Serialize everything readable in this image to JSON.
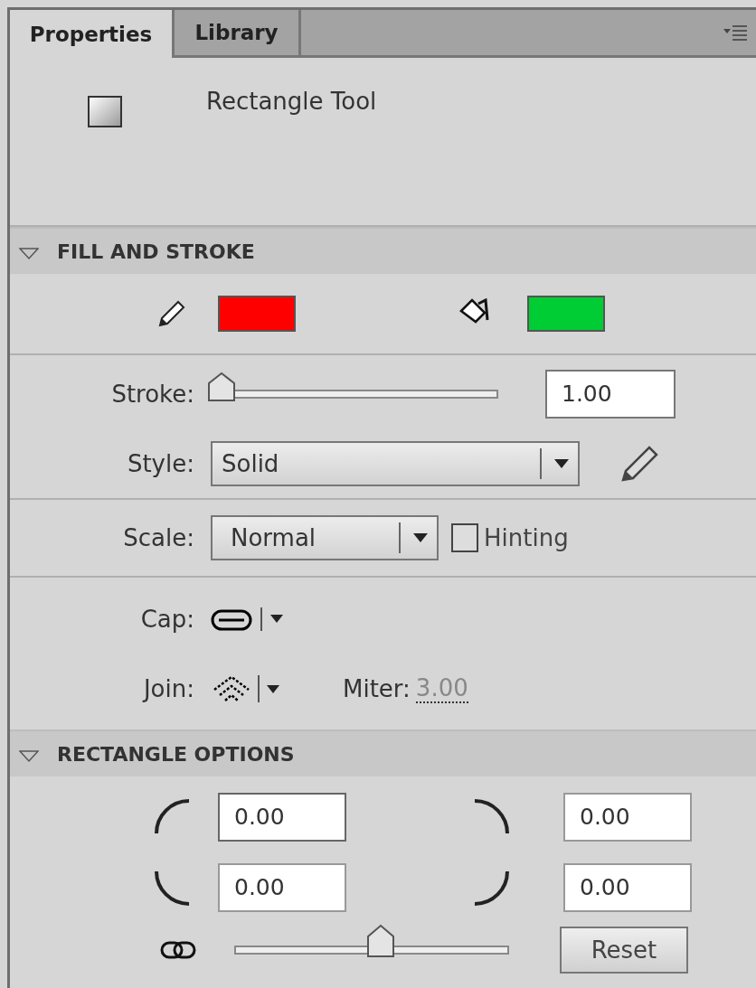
{
  "tabs": [
    {
      "label": "Properties",
      "selected": true
    },
    {
      "label": "Library",
      "selected": false
    }
  ],
  "tool": {
    "name": "Rectangle Tool"
  },
  "fill_and_stroke": {
    "title": "FILL AND STROKE",
    "expanded": true,
    "swatches": [
      {
        "kind": "stroke",
        "color": "#ff0000"
      },
      {
        "kind": "fill",
        "color": "#00cc33"
      }
    ],
    "stroke": {
      "label": "Stroke:",
      "level": 0,
      "value": "1.00"
    },
    "style": {
      "label": "Style:",
      "value": "Solid"
    },
    "scale": {
      "label": "Scale:",
      "value": "Normal"
    },
    "hinting": {
      "label": "Hinting",
      "checked": false
    },
    "cap": {
      "label": "Cap:"
    },
    "join": {
      "label": "Join:"
    },
    "miter": {
      "label": "Miter:",
      "value": "3.00"
    }
  },
  "rectangle_options": {
    "title": "RECTANGLE OPTIONS",
    "expanded": true,
    "corners": [
      "0.00",
      "0.00",
      "0.00",
      "0.00"
    ],
    "radius": {
      "level": 0.5
    },
    "reset": "Reset"
  }
}
